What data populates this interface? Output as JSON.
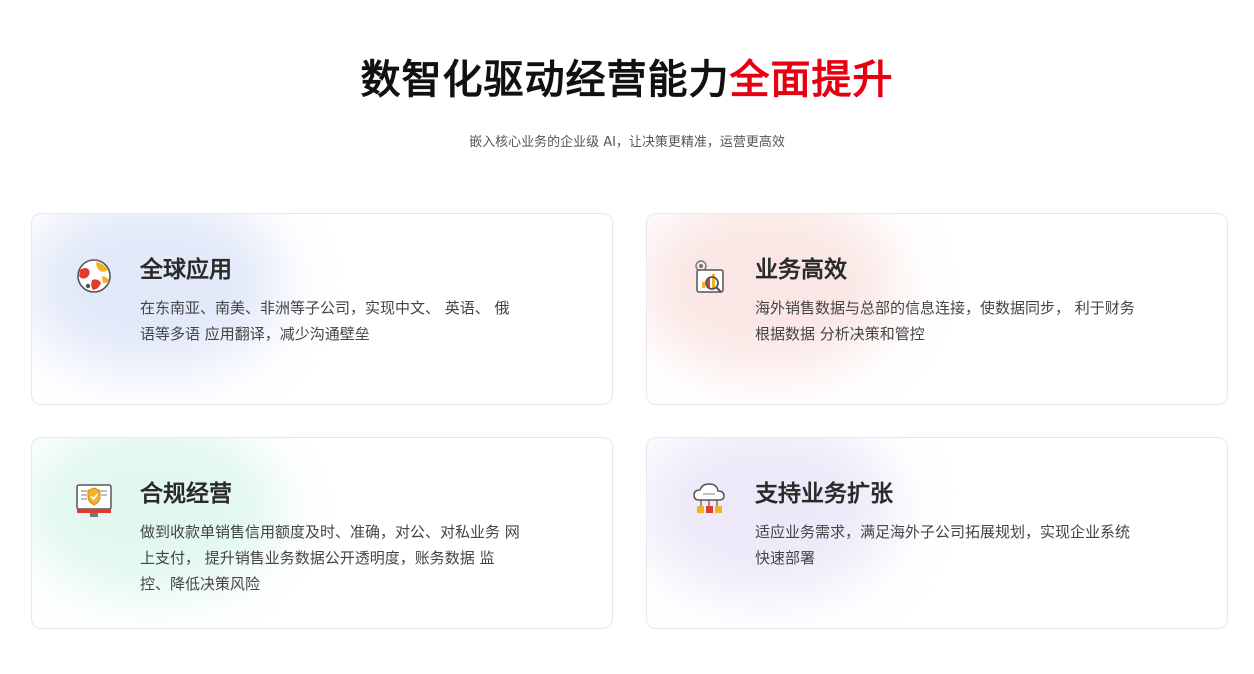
{
  "header": {
    "title_main": "数智化驱动经营能力",
    "title_accent": "全面提升",
    "subtitle": "嵌入核心业务的企业级 AI，让决策更精准，运营更高效"
  },
  "cards": [
    {
      "title": "全球应用",
      "desc": "在东南亚、南美、非洲等子公司，实现中文、 英语、 俄语等多语 应用翻译，减少沟通壁垒",
      "icon": "globe-icon"
    },
    {
      "title": "业务高效",
      "desc": "海外销售数据与总部的信息连接，使数据同步， 利于财务根据数据 分析决策和管控",
      "icon": "data-analysis-icon"
    },
    {
      "title": "合规经营",
      "desc": "做到收款单销售信用额度及时、准确，对公、对私业务 网上支付， 提升销售业务数据公开透明度，账务数据 监控、降低决策风险",
      "icon": "shield-monitor-icon"
    },
    {
      "title": "支持业务扩张",
      "desc": "适应业务需求，满足海外子公司拓展规划，实现企业系统快速部署",
      "icon": "cloud-network-icon"
    }
  ],
  "colors": {
    "accent": "#e60012",
    "title": "#111111",
    "card_border": "#e8e8ec"
  }
}
